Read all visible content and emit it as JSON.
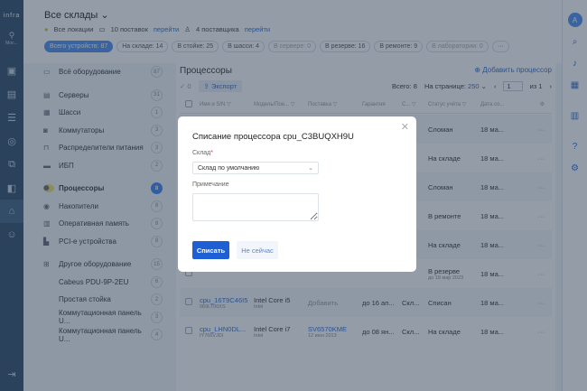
{
  "rail": {
    "logo": "infra",
    "location": "Мос..."
  },
  "header": {
    "title": "Все склады",
    "locations": "Все локации",
    "deliveries": "10 поставок",
    "deliveries_link": "перейти",
    "suppliers": "4 поставщика",
    "suppliers_link": "перейти"
  },
  "chips": [
    "Всего устройств: 87",
    "На складе: 14",
    "В стойке: 25",
    "В шасси: 4",
    "В сервере: 0",
    "В резерве: 16",
    "В ремонте: 9",
    "В лаборатории: 0",
    "···"
  ],
  "sidebar": [
    {
      "label": "Всё оборудование",
      "count": "87",
      "icon": "all"
    },
    {
      "label": "Серверы",
      "count": "31",
      "icon": "server"
    },
    {
      "label": "Шасси",
      "count": "1",
      "icon": "chassis"
    },
    {
      "label": "Коммутаторы",
      "count": "3",
      "icon": "switch"
    },
    {
      "label": "Распределители питания",
      "count": "3",
      "icon": "pdu"
    },
    {
      "label": "ИБП",
      "count": "2",
      "icon": "ups"
    },
    {
      "label": "Процессоры",
      "count": "8",
      "icon": "cpu"
    },
    {
      "label": "Накопители",
      "count": "8",
      "icon": "disk"
    },
    {
      "label": "Оперативная память",
      "count": "8",
      "icon": "ram"
    },
    {
      "label": "PCI-e устройства",
      "count": "8",
      "icon": "pci"
    },
    {
      "label": "Другое оборудование",
      "count": "15",
      "icon": "other"
    },
    {
      "label": "Cabeus PDU-9P-2EU",
      "count": "6"
    },
    {
      "label": "Простая стойка",
      "count": "2"
    },
    {
      "label": "Коммутационная панель U...",
      "count": "3"
    },
    {
      "label": "Коммутационная панель U...",
      "count": "4"
    }
  ],
  "main": {
    "title": "Процессоры",
    "add": "Добавить процессор",
    "selected": "0",
    "export": "Экспорт",
    "total": "Всего: 8",
    "per_page_label": "На странице:",
    "per_page": "250",
    "page": "1",
    "of": "из 1",
    "columns": [
      "Имя и S/N",
      "Модель/Пое...",
      "Поставка",
      "Гарантия",
      "С...",
      "Статус учёта",
      "Дата со..."
    ],
    "rows": [
      {
        "status": "Сломан",
        "date": "18 ма..."
      },
      {
        "status": "На складе",
        "date": "18 ма..."
      },
      {
        "status": "Сломан",
        "date": "18 ма..."
      },
      {
        "status": "В ремонте",
        "date": "18 ма..."
      },
      {
        "status": "На складе",
        "date": "18 ма..."
      },
      {
        "status": "В резерве",
        "status_sub": "до 18 мар 2023",
        "date": "18 ма..."
      },
      {
        "name": "cpu_16T9C46I5",
        "sn": "069LT00XS",
        "model": "Intel Core i5",
        "vendor": "Intel",
        "delivery": "Добавить",
        "warranty": "до 16 ап...",
        "loc": "Скл...",
        "status": "Списан",
        "date": "18 ма..."
      },
      {
        "name": "cpu_LHN0DL...",
        "sn": "IY766VJDI",
        "model": "Intel Core i7",
        "vendor": "Intel",
        "delivery": "SV6570KME",
        "delivery_date": "12 июн 2013",
        "warranty": "до 08 ян...",
        "loc": "Скл...",
        "status": "На складе",
        "date": "18 ма..."
      }
    ]
  },
  "modal": {
    "title": "Списание процессора cpu_C3BUQXH9U",
    "warehouse_label": "Склад",
    "required": "*",
    "warehouse_value": "Склад по умолчанию",
    "note_label": "Примечание",
    "note_value": "",
    "submit": "Списать",
    "cancel": "Не сейчас"
  }
}
